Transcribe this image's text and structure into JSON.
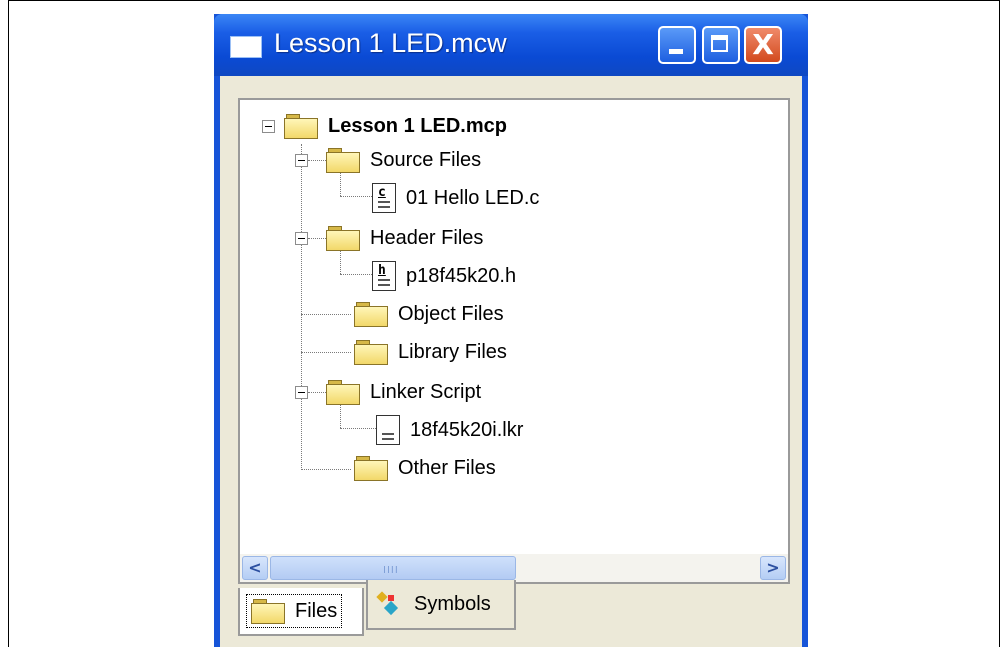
{
  "window": {
    "title": "Lesson 1 LED.mcw",
    "minimize_label": "",
    "maximize_label": "",
    "close_label": "X"
  },
  "tree": {
    "project": {
      "label": "Lesson 1 LED.mcp",
      "icon": "folder-icon",
      "expanded": true
    },
    "nodes": [
      {
        "label": "Source Files",
        "icon": "folder-icon",
        "expanded": true,
        "children": [
          {
            "label": "01 Hello LED.c",
            "icon": "c-file-icon",
            "glyph": "c"
          }
        ]
      },
      {
        "label": "Header Files",
        "icon": "folder-icon",
        "expanded": true,
        "children": [
          {
            "label": "p18f45k20.h",
            "icon": "h-file-icon",
            "glyph": "h"
          }
        ]
      },
      {
        "label": "Object Files",
        "icon": "folder-icon"
      },
      {
        "label": "Library Files",
        "icon": "folder-icon"
      },
      {
        "label": "Linker Script",
        "icon": "folder-icon",
        "expanded": true,
        "children": [
          {
            "label": "18f45k20i.lkr",
            "icon": "linker-file-icon",
            "glyph": ""
          }
        ]
      },
      {
        "label": "Other Files",
        "icon": "folder-icon"
      }
    ]
  },
  "scrollbar": {
    "grip": "IIII",
    "left_arrow": "<",
    "right_arrow": ">"
  },
  "tabs": [
    {
      "label": "Files",
      "icon": "folder-icon",
      "selected": true
    },
    {
      "label": "Symbols",
      "icon": "symbols-icon",
      "selected": false
    }
  ],
  "colors": {
    "titlebar": "#0a4ad4",
    "client": "#ece9d8",
    "close_button": "#d24a1e"
  }
}
